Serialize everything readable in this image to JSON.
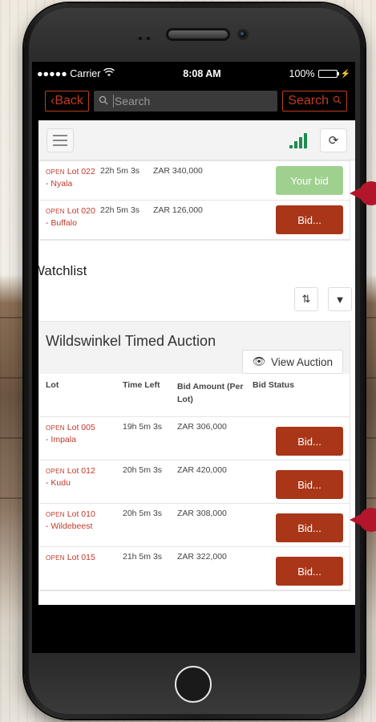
{
  "status_bar": {
    "carrier": "●●●●● Carrier",
    "wifi": "wifi-icon",
    "time": "8:08 AM",
    "battery": "100%"
  },
  "navbar": {
    "back_label": "Back",
    "search_placeholder": "Search",
    "search_button": "Search"
  },
  "colors": {
    "accent": "#c13b1b",
    "bid_button": "#a93618",
    "your_bid_button": "#9fd08f",
    "lot_text": "#c0392b",
    "signal": "#1e8c4f",
    "callout": "#b3162b"
  },
  "active_lots": [
    {
      "status": "OPEN",
      "lot": "Lot 022",
      "name": "- Nyala",
      "time_left": "22h 5m 3s",
      "amount": "ZAR 340,000",
      "action": "Your bid"
    },
    {
      "status": "OPEN",
      "lot": "Lot 020",
      "name": "- Buffalo",
      "time_left": "22h 5m 3s",
      "amount": "ZAR 126,000",
      "action": "Bid..."
    }
  ],
  "watchlist": {
    "title": "Watchlist",
    "auction_title": "Wildswinkel Timed Auction",
    "view_button": "View Auction",
    "columns": {
      "lot": "Lot",
      "time_left": "Time Left",
      "bid_amount": "Bid Amount (Per Lot)",
      "bid_status": "Bid Status"
    },
    "rows": [
      {
        "status": "OPEN",
        "lot": "Lot 005",
        "name": "- Impala",
        "time_left": "19h 5m 3s",
        "amount": "ZAR 306,000",
        "action": "Bid..."
      },
      {
        "status": "OPEN",
        "lot": "Lot 012",
        "name": "- Kudu",
        "time_left": "20h 5m 3s",
        "amount": "ZAR 420,000",
        "action": "Bid..."
      },
      {
        "status": "OPEN",
        "lot": "Lot 010",
        "name": "- Wildebeest",
        "time_left": "20h 5m 3s",
        "amount": "ZAR 308,000",
        "action": "Bid..."
      },
      {
        "status": "OPEN",
        "lot": "Lot 015",
        "name": "",
        "time_left": "21h 5m 3s",
        "amount": "ZAR 322,000",
        "action": "Bid..."
      }
    ]
  }
}
